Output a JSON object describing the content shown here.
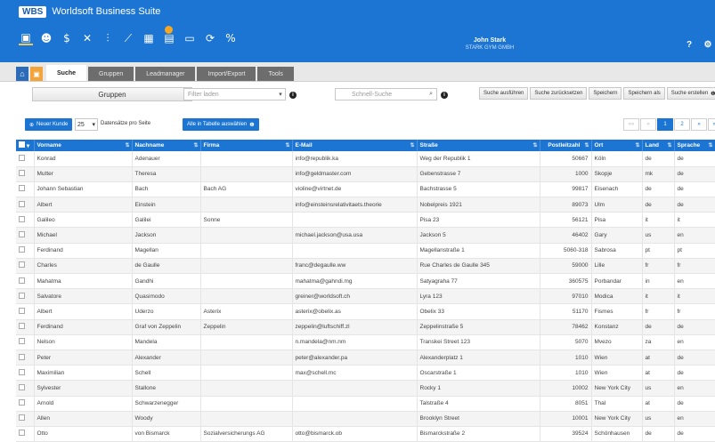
{
  "app": {
    "badge": "WBS",
    "title": "Worldsoft Business Suite"
  },
  "user": {
    "name": "John Stark",
    "company": "STARK GYM GMBH"
  },
  "header_icons": {
    "help": "?",
    "settings": "⚙"
  },
  "toolbar_icons": [
    "address-card-icon",
    "users-icon",
    "coins-icon",
    "tools-icon",
    "dollar-chart-icon",
    "line-chart-icon",
    "calendar-icon",
    "document-icon",
    "monitor-icon",
    "refresh-icon",
    "percent-icon"
  ],
  "tabs": [
    "Suche",
    "Gruppen",
    "Leadmanager",
    "Import/Export",
    "Tools"
  ],
  "search": {
    "groups_button": "Gruppen",
    "filter_placeholder": "Filter laden",
    "quick_placeholder": "Schnell-Suche",
    "buttons": [
      "Suche ausführen",
      "Suche zurücksetzen",
      "Speichern",
      "Speichern als",
      "Suche erstellen"
    ]
  },
  "controls": {
    "new_customer": "Neuer Kunde",
    "page_size": "25",
    "page_size_label": "Datensätze pro Seite",
    "select_all": "Alle in Tabelle auswählen"
  },
  "pager": [
    "««",
    "«",
    "1",
    "2",
    "»",
    "»»"
  ],
  "table": {
    "columns": [
      "Vorname",
      "Nachname",
      "Firma",
      "E-Mail",
      "Straße",
      "Postleitzahl",
      "Ort",
      "Land",
      "Sprache"
    ],
    "rows": [
      [
        "Konrad",
        "Adenauer",
        "",
        "info@republik.ka",
        "Weg der Republik 1",
        "50667",
        "Köln",
        "de",
        "de"
      ],
      [
        "Mutter",
        "Theresa",
        "",
        "info@geldmaster.com",
        "Gebenstrasse 7",
        "1000",
        "Skopje",
        "mk",
        "de"
      ],
      [
        "Johann Sebastian",
        "Bach",
        "Bach AG",
        "violine@virtnet.de",
        "Bachstrasse 5",
        "99817",
        "Eisenach",
        "de",
        "de"
      ],
      [
        "Albert",
        "Einstein",
        "",
        "info@einsteinsrelativitaets.theorie",
        "Nobelpreis 1921",
        "89073",
        "Ulm",
        "de",
        "de"
      ],
      [
        "Galileo",
        "Galilei",
        "Sonne",
        "",
        "Pisa 23",
        "56121",
        "Pisa",
        "it",
        "it"
      ],
      [
        "Michael",
        "Jackson",
        "",
        "michael.jackson@usa.usa",
        "Jackson 5",
        "46402",
        "Gary",
        "us",
        "en"
      ],
      [
        "Ferdinand",
        "Magellan",
        "",
        "",
        "Magellanstraße 1",
        "5060-318",
        "Sabrosa",
        "pt",
        "pt"
      ],
      [
        "Charles",
        "de Gaulle",
        "",
        "franc@degaulle.ww",
        "Rue Charles de Gaulle 345",
        "59000",
        "Lille",
        "fr",
        "fr"
      ],
      [
        "Mahatma",
        "Gandhi",
        "",
        "mahatma@gahndi.mg",
        "Satyagraha 77",
        "360575",
        "Porbandar",
        "in",
        "en"
      ],
      [
        "Salvatore",
        "Quasimodo",
        "",
        "greiner@worldsoft.ch",
        "Lyra 123",
        "97010",
        "Modica",
        "it",
        "it"
      ],
      [
        "Albert",
        "Uderzo",
        "Asterix",
        "asterix@obelix.as",
        "Obelix 33",
        "51170",
        "Fismes",
        "fr",
        "fr"
      ],
      [
        "Ferdinand",
        "Graf von Zeppelin",
        "Zeppelin",
        "zeppelin@luftschiff.zl",
        "Zeppelinstraße 5",
        "78462",
        "Konstanz",
        "de",
        "de"
      ],
      [
        "Nelson",
        "Mandela",
        "",
        "n.mandela@nm.nm",
        "Transkei Street 123",
        "5070",
        "Mvezo",
        "za",
        "en"
      ],
      [
        "Peter",
        "Alexander",
        "",
        "peter@alexander.pa",
        "Alexanderplatz 1",
        "1010",
        "Wien",
        "at",
        "de"
      ],
      [
        "Maximilian",
        "Schell",
        "",
        "max@schell.mc",
        "Oscarstraße 1",
        "1010",
        "Wien",
        "at",
        "de"
      ],
      [
        "Sylvester",
        "Stallone",
        "",
        "",
        "Rocky 1",
        "10002",
        "New York City",
        "us",
        "en"
      ],
      [
        "Arnold",
        "Schwarzenegger",
        "",
        "",
        "Talstraße 4",
        "8051",
        "Thal",
        "at",
        "de"
      ],
      [
        "Allen",
        "Woody",
        "",
        "",
        "Brooklyn Street",
        "10001",
        "New York City",
        "us",
        "en"
      ],
      [
        "Otto",
        "von Bismarck",
        "Sozialversicherungs AG",
        "otto@bismarck.ob",
        "Bismarckstraße 2",
        "39524",
        "Schönhausen",
        "de",
        "de"
      ]
    ]
  }
}
